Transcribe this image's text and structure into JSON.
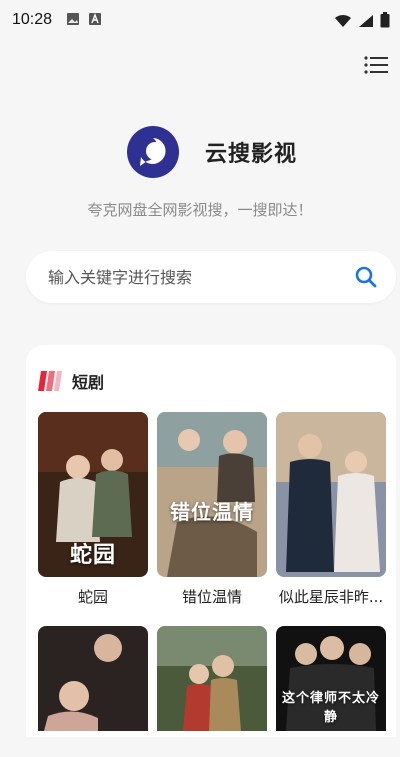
{
  "status_bar": {
    "time": "10:28",
    "left_icons": [
      "image-icon",
      "font-a-icon"
    ],
    "right_icons": [
      "wifi-icon",
      "signal-icon",
      "battery-icon"
    ]
  },
  "app": {
    "title": "云搜影视",
    "tagline": "夸克网盘全网影视搜，一搜即达！",
    "brand_color": "#2e3192"
  },
  "search": {
    "placeholder": "输入关键字进行搜索",
    "accent": "#1a73e8"
  },
  "section": {
    "title": "短剧",
    "items": [
      {
        "label": "蛇园",
        "poster_text": "蛇园",
        "poster_colors": [
          "#3a2418",
          "#c9a27a"
        ]
      },
      {
        "label": "错位温情",
        "poster_text": "错位温情",
        "poster_colors": [
          "#b9a48a",
          "#6d5b47"
        ]
      },
      {
        "label": "似此星辰非昨...",
        "poster_text": "",
        "poster_colors": [
          "#1f2a3a",
          "#8a92a6"
        ]
      },
      {
        "label": "",
        "poster_text": "",
        "poster_colors": [
          "#2b2222",
          "#cfa59a"
        ]
      },
      {
        "label": "",
        "poster_text": "",
        "poster_colors": [
          "#4a5a3a",
          "#a98a5c"
        ]
      },
      {
        "label": "",
        "poster_text": "这个律师不太冷静",
        "poster_colors": [
          "#111111",
          "#3a3a3a"
        ]
      }
    ]
  }
}
